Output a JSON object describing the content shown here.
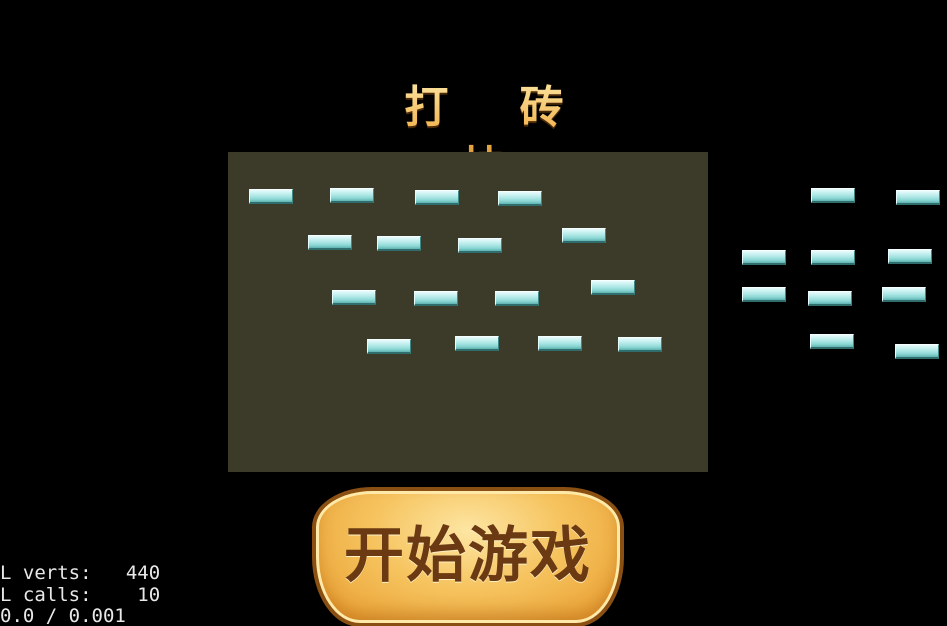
{
  "title": "打 砖 块",
  "start_button": {
    "label": "开始游戏"
  },
  "colors": {
    "background": "#000000",
    "preview_panel": "#3c3a29",
    "brick": "#a9e4e3",
    "title_gold": "#e9a43e",
    "button_fill": "#f6c35e",
    "button_text": "#6b3a12",
    "debug_text": "#e8e8e8"
  },
  "debug_stats": {
    "line1": "L verts:   440",
    "line2": "L calls:    10",
    "line3": "0.0 / 0.001"
  }
}
